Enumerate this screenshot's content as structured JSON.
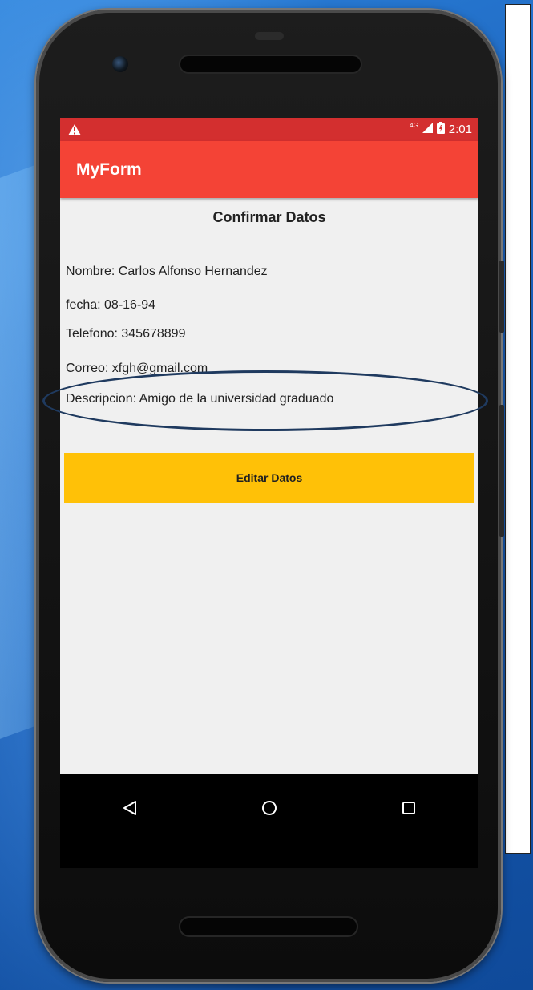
{
  "status_bar": {
    "time": "2:01",
    "network": "4G",
    "warning_icon": "warning-icon",
    "signal_icon": "signal-icon",
    "battery_icon": "battery-icon"
  },
  "app_bar": {
    "title": "MyForm"
  },
  "form": {
    "title": "Confirmar Datos",
    "nombre": "Nombre: Carlos Alfonso Hernandez",
    "fecha": "fecha: 08-16-94",
    "telefono": "Telefono: 345678899",
    "correo": "Correo: xfgh@gmail.com",
    "descripcion": "Descripcion: Amigo de la universidad graduado"
  },
  "edit_button": {
    "label": "Editar Datos"
  },
  "nav_bar": {
    "icons": [
      "back-icon",
      "home-icon",
      "recents-icon"
    ]
  },
  "colors": {
    "status_bar": "#d32f2f",
    "app_bar": "#f44336",
    "button": "#ffc107",
    "background": "#f0f0f0",
    "highlight_ellipse": "#1f3a5f"
  }
}
